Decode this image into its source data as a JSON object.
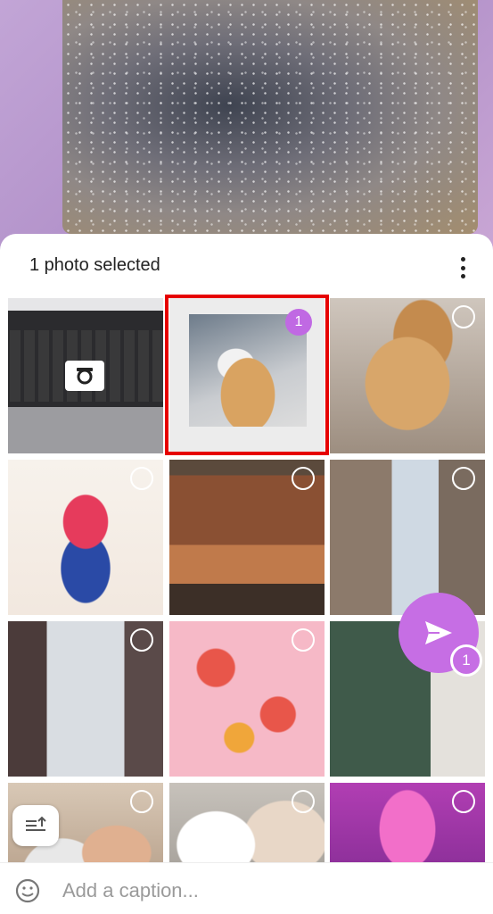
{
  "header": {
    "title": "1 photo selected",
    "menu_icon": "more-vertical-icon"
  },
  "gallery": {
    "tiles": [
      {
        "name": "laptop-keyboard-photo",
        "selected": false,
        "camera": true
      },
      {
        "name": "cat-paw-photo",
        "selected": true,
        "selection_number": "1",
        "highlighted": true
      },
      {
        "name": "cat-smiling-photo",
        "selected": false
      },
      {
        "name": "illustration-poster-photo",
        "selected": false
      },
      {
        "name": "bedroom-photo",
        "selected": false
      },
      {
        "name": "room-window-photo",
        "selected": false
      },
      {
        "name": "window-curtains-photo",
        "selected": false
      },
      {
        "name": "pink-illustration-photo",
        "selected": false
      },
      {
        "name": "hallway-photo",
        "selected": false
      },
      {
        "name": "girl-with-cat-photo",
        "selected": false
      },
      {
        "name": "food-photo",
        "selected": false
      },
      {
        "name": "pink-portrait-photo",
        "selected": false
      }
    ]
  },
  "caption": {
    "placeholder": "Add a caption...",
    "emoji_icon": "emoji-smile-icon"
  },
  "send": {
    "icon": "send-icon",
    "count": "1"
  },
  "colors": {
    "accent": "#c66ee4",
    "highlight": "#e60000"
  }
}
